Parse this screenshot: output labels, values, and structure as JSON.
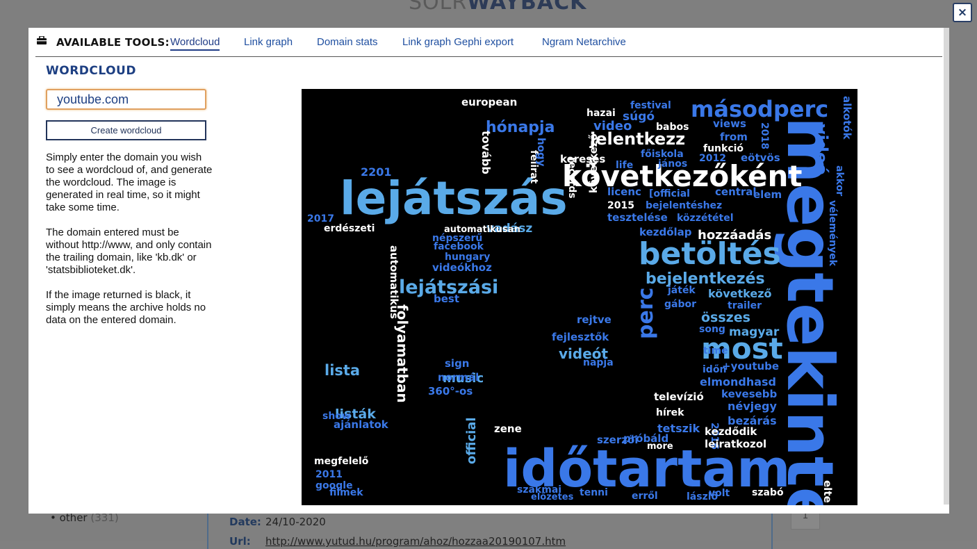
{
  "background": {
    "logo_light": "SOLR",
    "logo_bold": "WAYBACK",
    "facet_other_label": "other",
    "facet_other_count": "(331)",
    "date_label": "Date:",
    "date_value": "24/10-2020",
    "url_label": "Url:",
    "url_value": "http://www.yutud.hu/program/ahoz/hozzaa20190107.htm",
    "pager_label": "1"
  },
  "close_button": {
    "label": "×"
  },
  "toolbar": {
    "title": "AVAILABLE TOOLS:",
    "tabs": [
      {
        "label": "Wordcloud",
        "active": true
      },
      {
        "label": "Link graph",
        "active": false
      },
      {
        "label": "Domain stats",
        "active": false
      },
      {
        "label": "Link graph Gephi export",
        "active": false
      },
      {
        "label": "Ngram Netarchive",
        "active": false
      }
    ]
  },
  "wordcloud_panel": {
    "title": "WORDCLOUD",
    "domain_value": "youtube.com",
    "create_button": "Create wordcloud",
    "help": [
      "Simply enter the domain you wish to see a wordcloud of, and generate the wordcloud. The image is generated in real time, so it might take some time.",
      "The domain entered must be without http://www, and only contain the trailing domain, like 'kb.dk' or 'statsbiblioteket.dk'.",
      "If the image returned is black, it simply means the archive holds no data on the entered domain."
    ]
  },
  "colors": {
    "brand": "#1d3f82",
    "input_border": "#e0a060",
    "cloud_bg": "#000000",
    "word_palette": [
      "#ffffff",
      "#3a78e8",
      "#2f5fd0",
      "#5aaae8",
      "#4b8ff0",
      "#2346b8"
    ]
  },
  "wordcloud_words": [
    {
      "t": "megtekintés",
      "c": 1
    },
    {
      "t": "időtartam",
      "c": 1
    },
    {
      "t": "lejátszás",
      "c": 3
    },
    {
      "t": "következőként",
      "c": 0
    },
    {
      "t": "betöltés",
      "c": 3
    },
    {
      "t": "most",
      "c": 3
    },
    {
      "t": "másodperc",
      "c": 1
    },
    {
      "t": "bejelentkezés",
      "c": 3
    },
    {
      "t": "lejátszási",
      "c": 3
    },
    {
      "t": "jelentkezz",
      "c": 0
    },
    {
      "t": "videó",
      "c": 1
    },
    {
      "t": "hónapja",
      "c": 1
    },
    {
      "t": "perc",
      "c": 1
    },
    {
      "t": "folyamatban",
      "c": 0
    },
    {
      "t": "összes",
      "c": 3
    },
    {
      "t": "videót",
      "c": 3
    },
    {
      "t": "következő",
      "c": 3
    },
    {
      "t": "magyar",
      "c": 3
    },
    {
      "t": "hozzáadás",
      "c": 0
    },
    {
      "t": "lista",
      "c": 3
    },
    {
      "t": "official",
      "c": 3
    },
    {
      "t": "music",
      "c": 3
    },
    {
      "t": "listák",
      "c": 3
    },
    {
      "t": "vadász",
      "c": 3
    },
    {
      "t": "european",
      "c": 0
    },
    {
      "t": "video",
      "c": 1
    },
    {
      "t": "súgó",
      "c": 1
    },
    {
      "t": "babos",
      "c": 0
    },
    {
      "t": "funkció",
      "c": 0
    },
    {
      "t": "keresés",
      "c": 0
    },
    {
      "t": "hazai",
      "c": 0
    },
    {
      "t": "festival",
      "c": 1
    },
    {
      "t": "views",
      "c": 1
    },
    {
      "t": "from",
      "c": 1
    },
    {
      "t": "eötvös",
      "c": 1
    },
    {
      "t": "2012",
      "c": 1
    },
    {
      "t": "jános",
      "c": 1
    },
    {
      "t": "főiskola",
      "c": 1
    },
    {
      "t": "life",
      "c": 1
    },
    {
      "t": "licenc",
      "c": 1
    },
    {
      "t": "[official",
      "c": 1
    },
    {
      "t": "central",
      "c": 1
    },
    {
      "t": "elem",
      "c": 1
    },
    {
      "t": "2015",
      "c": 0
    },
    {
      "t": "bejelentéshez",
      "c": 1
    },
    {
      "t": "tesztelése",
      "c": 1
    },
    {
      "t": "közzététel",
      "c": 1
    },
    {
      "t": "kezdőlap",
      "c": 1
    },
    {
      "t": "játék",
      "c": 1
    },
    {
      "t": "gábor",
      "c": 1
    },
    {
      "t": "trailer",
      "c": 1
    },
    {
      "t": "song",
      "c": 1
    },
    {
      "t": "időn",
      "c": 1
    },
    {
      "t": "+youtube",
      "c": 1
    },
    {
      "t": "time",
      "c": 1
    },
    {
      "t": "elmondhasd",
      "c": 1
    },
    {
      "t": "kevesebb",
      "c": 1
    },
    {
      "t": "névjegy",
      "c": 1
    },
    {
      "t": "bezárás",
      "c": 1
    },
    {
      "t": "2016",
      "c": 1
    },
    {
      "t": "kezdődik",
      "c": 0
    },
    {
      "t": "leiratkozol",
      "c": 0
    },
    {
      "t": "televízió",
      "c": 0
    },
    {
      "t": "hírek",
      "c": 0
    },
    {
      "t": "tetszik",
      "c": 1
    },
    {
      "t": "szerzői",
      "c": 1
    },
    {
      "t": "próbáld",
      "c": 1
    },
    {
      "t": "more",
      "c": 0
    },
    {
      "t": "zene",
      "c": 0
    },
    {
      "t": "rejtve",
      "c": 1
    },
    {
      "t": "fejlesztők",
      "c": 1
    },
    {
      "t": "napja",
      "c": 1
    },
    {
      "t": "népszerű",
      "c": 1
    },
    {
      "t": "facebook",
      "c": 1
    },
    {
      "t": "hungary",
      "c": 1
    },
    {
      "t": "videókhoz",
      "c": 1
    },
    {
      "t": "best",
      "c": 1
    },
    {
      "t": "sign",
      "c": 1
    },
    {
      "t": "normál",
      "c": 1
    },
    {
      "t": "360°-os",
      "c": 1
    },
    {
      "t": "ajánlatok",
      "c": 1
    },
    {
      "t": "show",
      "c": 1
    },
    {
      "t": "google",
      "c": 1
    },
    {
      "t": "megfelelő",
      "c": 0
    },
    {
      "t": "2011",
      "c": 1
    },
    {
      "t": "filmek",
      "c": 1
    },
    {
      "t": "szakmai",
      "c": 1
    },
    {
      "t": "előzetes",
      "c": 1
    },
    {
      "t": "tenni",
      "c": 1
    },
    {
      "t": "erről",
      "c": 1
    },
    {
      "t": "volt",
      "c": 1
    },
    {
      "t": "lászló",
      "c": 1
    },
    {
      "t": "szabó",
      "c": 0
    },
    {
      "t": "erdészeti",
      "c": 0
    },
    {
      "t": "2017",
      "c": 1
    },
    {
      "t": "2201",
      "c": 1
    },
    {
      "t": "automatikusan",
      "c": 0
    },
    {
      "t": "automatikus",
      "c": 0
    },
    {
      "t": "következő",
      "c": 0
    },
    {
      "t": "elte",
      "c": 0
    },
    {
      "t": "alkotók",
      "c": 1
    },
    {
      "t": "vélemények",
      "c": 1
    },
    {
      "t": "akkor",
      "c": 1
    },
    {
      "t": "2018",
      "c": 1
    },
    {
      "t": "tovább",
      "c": 0
    },
    {
      "t": "felirat",
      "c": 0
    },
    {
      "t": "records",
      "c": 0
    },
    {
      "t": "hogy",
      "c": 1
    }
  ]
}
